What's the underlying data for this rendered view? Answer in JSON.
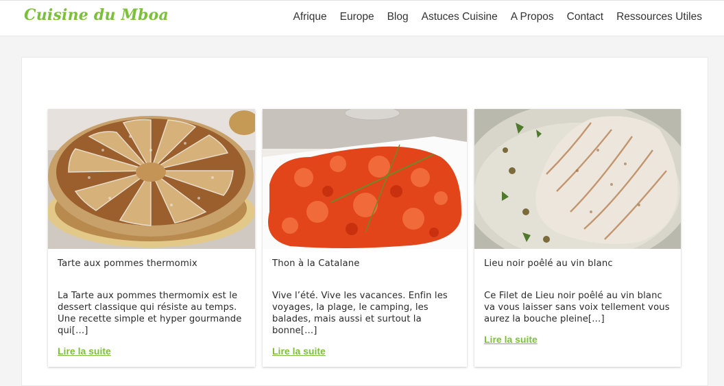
{
  "site": {
    "logo": "Cuisine du Mboa",
    "brand_color": "#7cbf3a"
  },
  "nav": {
    "items": [
      "Afrique",
      "Europe",
      "Blog",
      "Astuces Cuisine",
      "A Propos",
      "Contact",
      "Ressources Utiles"
    ]
  },
  "posts": [
    {
      "title": "Tarte aux pommes thermomix",
      "excerpt": "La Tarte aux pommes thermomix est le dessert classique qui résiste au temps. Une recette simple et hyper gourmande qui[…]",
      "read_more": "Lire la suite",
      "image_icon": "apple-tart-photo"
    },
    {
      "title": "Thon à la Catalane",
      "excerpt": "Vive l’été. Vive les vacances. Enfin les voyages, la plage, le camping, les balades, mais aussi et surtout la bonne[…]",
      "read_more": "Lire la suite",
      "image_icon": "tuna-catalan-photo"
    },
    {
      "title": "Lieu noir poêlé au vin blanc",
      "excerpt": "Ce Filet de Lieu noir poêlé au vin blanc va vous laisser sans voix tellement vous aurez la bouche pleine[…]",
      "read_more": "Lire la suite",
      "image_icon": "pollock-fillet-photo"
    }
  ]
}
